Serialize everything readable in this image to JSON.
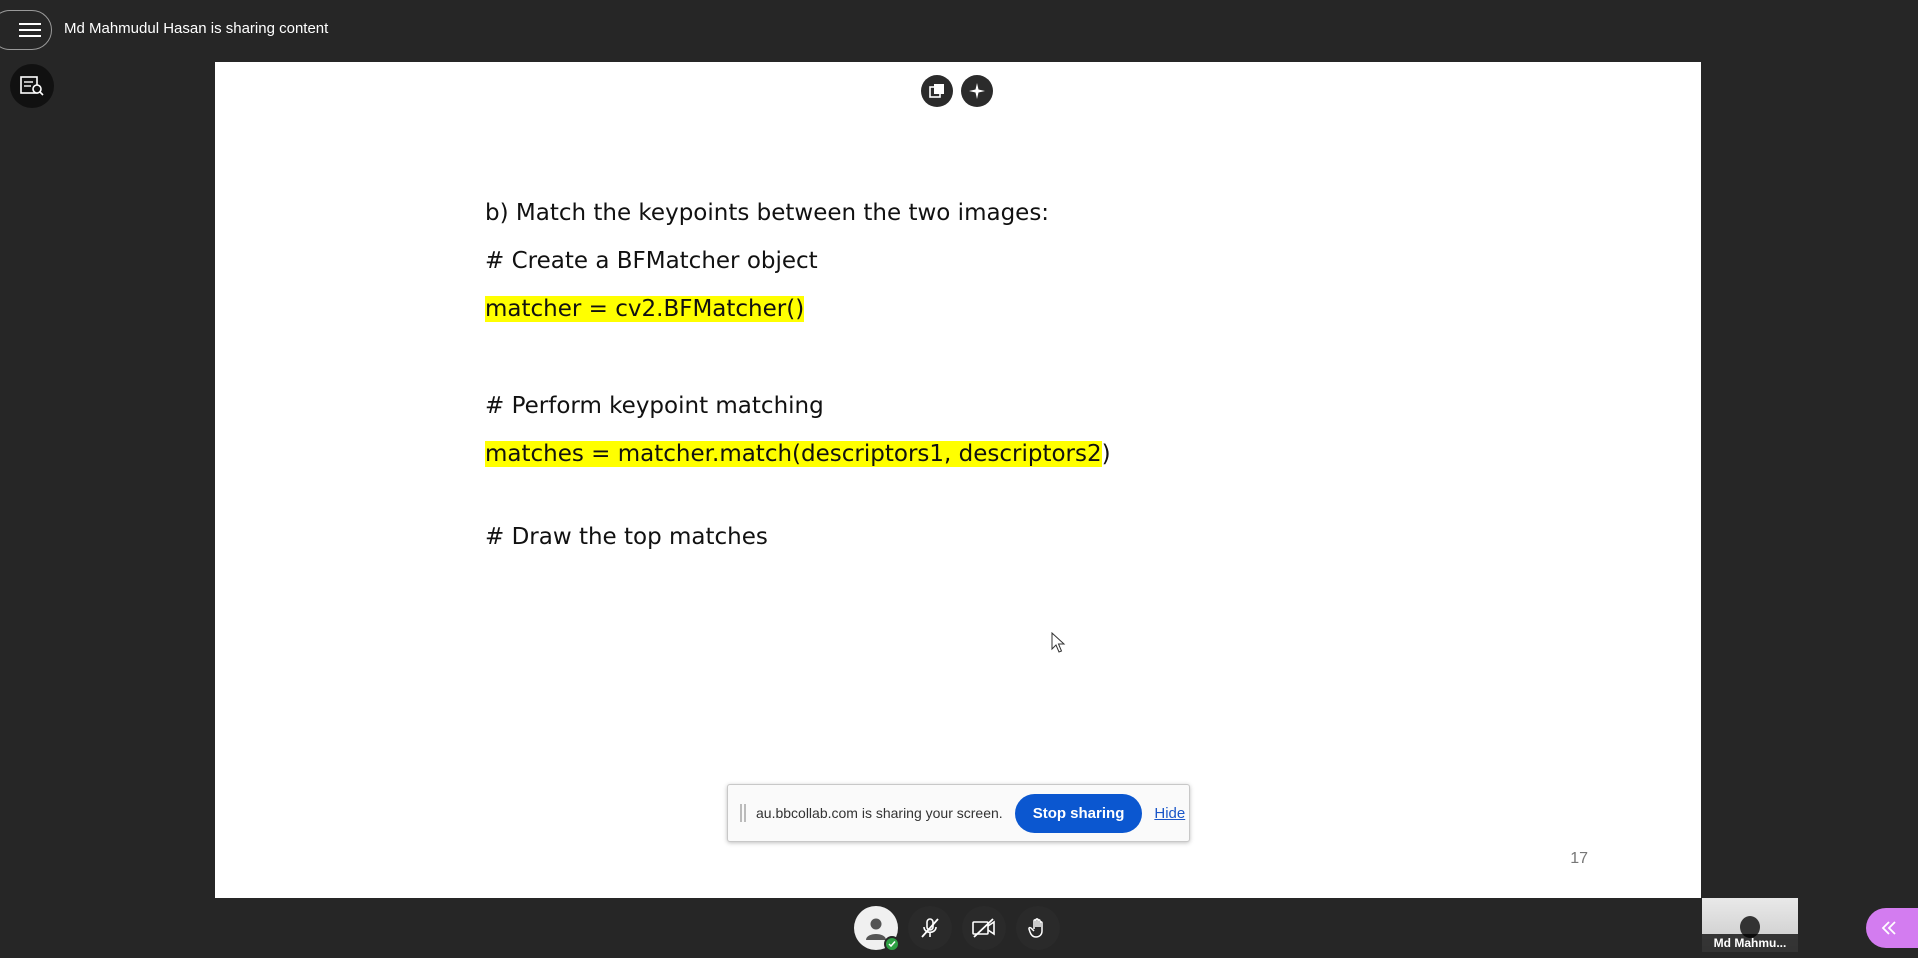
{
  "header": {
    "sharing_title": "Md Mahmudul Hasan is sharing content"
  },
  "slide": {
    "lines": [
      "b) Match the keypoints between the two images:",
      "# Create a BFMatcher object",
      "matcher = cv2.BFMatcher()",
      "# Perform keypoint matching",
      "matches = matcher.match(descriptors1, descriptors2",
      ")",
      "# Draw the top matches"
    ],
    "page_number": "17",
    "highlight_color": "#ffff00"
  },
  "share_notification": {
    "message": "au.bbcollab.com is sharing your screen.",
    "stop_label": "Stop sharing",
    "hide_label": "Hide",
    "button_color": "#0b57d0"
  },
  "participant": {
    "name": "Md Mahmu..."
  },
  "icons": {
    "menu": "hamburger-icon",
    "captions": "captions-search-icon",
    "slide_tools": [
      "pop-out-icon",
      "sparkle-icon"
    ],
    "controls": [
      "avatar-icon",
      "microphone-muted-icon",
      "camera-off-icon",
      "raise-hand-icon"
    ],
    "panel": "chevron-double-left-icon"
  },
  "colors": {
    "background": "#262626",
    "panel_toggle": "#d37cf0",
    "status_ok": "#2ea043"
  }
}
